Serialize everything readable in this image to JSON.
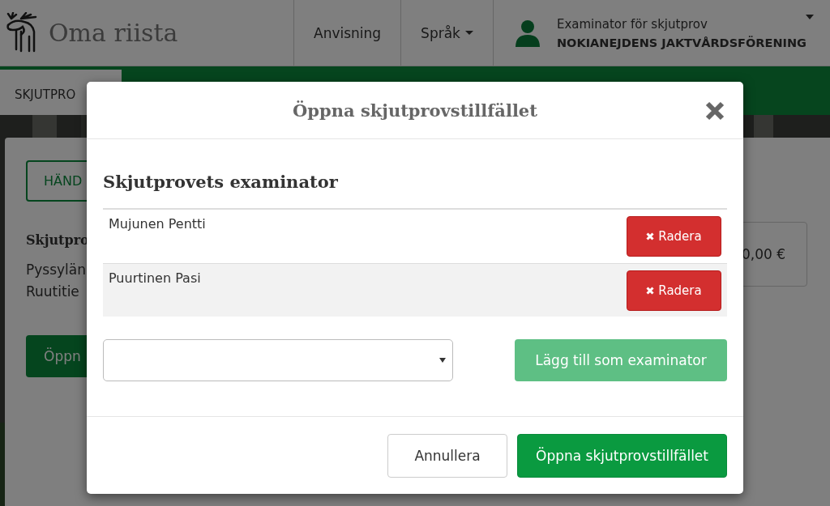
{
  "header": {
    "logo_text": "Oma riista",
    "nav": [
      {
        "label": "Anvisning",
        "dropdown": false
      },
      {
        "label": "Språk",
        "dropdown": true
      }
    ],
    "user": {
      "role": "Examinator för skjutprov",
      "organisation": "NOKIANEJDENS JAKTVÅRDSFÖRENING"
    }
  },
  "tab": {
    "label": "SKJUTPRO"
  },
  "card": {
    "outline_button": "HÄND",
    "heading": "Skjutpro",
    "lines": [
      "Pyssylän",
      "Ruutitie"
    ],
    "amount": "0,00 €",
    "primary_button": "Öppn"
  },
  "modal": {
    "title": "Öppna skjutprovstillfället",
    "section_title": "Skjutprovets examinator",
    "examiners": [
      {
        "name": "Mujunen Pentti",
        "delete_label": "Radera"
      },
      {
        "name": "Puurtinen Pasi",
        "delete_label": "Radera"
      }
    ],
    "add_button": {
      "label": "Lägg till som examinator",
      "disabled": true
    },
    "buttons": [
      {
        "label": "Annullera",
        "kind": "default"
      },
      {
        "label": "Öppna skjutprovstillfället",
        "kind": "primary"
      }
    ]
  }
}
